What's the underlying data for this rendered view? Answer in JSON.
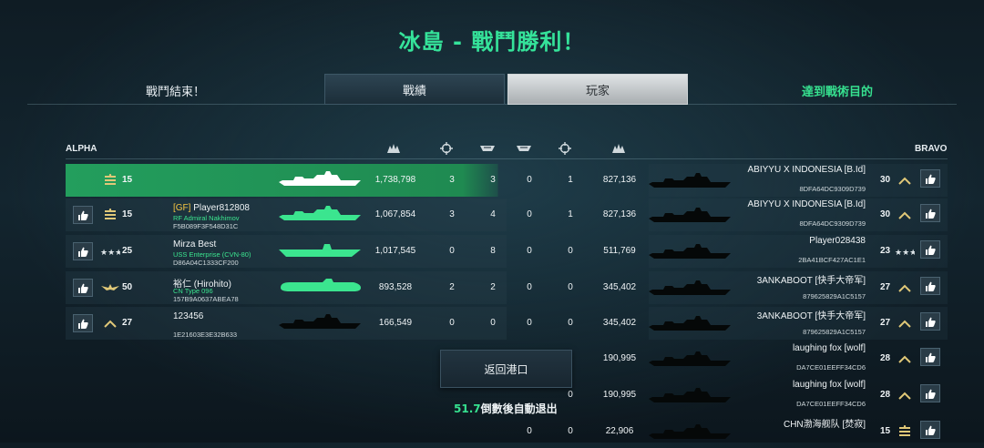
{
  "title": "冰島 - 戰鬥勝利！",
  "header": {
    "battle_end": "戰鬥結束！",
    "tabs": [
      "戰績",
      "玩家"
    ],
    "objective": "達到戰術目的"
  },
  "teams": {
    "left": "ALPHA",
    "right": "BRAVO"
  },
  "column_icons": [
    "damage-icon",
    "crosshair-icon",
    "ship-kill-icon",
    "ship-kill-icon",
    "crosshair-icon",
    "damage-icon"
  ],
  "rows": [
    {
      "left_rank": "15",
      "left_rank_icon": "rank-bars-icon",
      "left_clan": "",
      "left_name": "",
      "left_ship": "",
      "left_id": "",
      "damage_l": "1,738,798",
      "c1": "3",
      "c2": "3",
      "c3": "0",
      "c4": "1",
      "damage_r": "827,136",
      "right_name": "ABIYYU X INDONESIA ",
      "right_clan": "[B.Id]",
      "right_id": "8DFA64DC9309D739",
      "right_rank": "30",
      "right_rank_icon": "rank-chevron-icon",
      "highlight": true
    },
    {
      "left_rank": "15",
      "left_rank_icon": "rank-bars-icon",
      "left_clan": "[GF]",
      "left_name": " Player812808",
      "left_ship": "RF Admiral Nakhimov",
      "left_id": "F5B089F3F548D31C",
      "damage_l": "1,067,854",
      "c1": "3",
      "c2": "4",
      "c3": "0",
      "c4": "1",
      "damage_r": "827,136",
      "right_name": "ABIYYU X INDONESIA ",
      "right_clan": "[B.Id]",
      "right_id": "8DFA64DC9309D739",
      "right_rank": "30",
      "right_rank_icon": "rank-chevron-icon",
      "highlight": false
    },
    {
      "left_rank": "25",
      "left_rank_icon": "rank-stars-icon",
      "left_clan": "",
      "left_name": "Mirza Best",
      "left_ship": "USS Enterprise (CVN-80)",
      "left_id": "D86A04C1333CF200",
      "damage_l": "1,017,545",
      "c1": "0",
      "c2": "8",
      "c3": "0",
      "c4": "0",
      "damage_r": "511,769",
      "right_name": "Player028438",
      "right_clan": "",
      "right_id": "2BA41BCF427AC1E1",
      "right_rank": "23",
      "right_rank_icon": "rank-stars-icon",
      "highlight": false
    },
    {
      "left_rank": "50",
      "left_rank_icon": "rank-eagle-icon",
      "left_clan": "",
      "left_name": "裕仁 (Hirohito)",
      "left_ship": "CN Type 096",
      "left_id": "157B9A0637ABEA78",
      "damage_l": "893,528",
      "c1": "2",
      "c2": "2",
      "c3": "0",
      "c4": "0",
      "damage_r": "345,402",
      "right_name": "3ANKABOOT ",
      "right_clan": "[快手大帝军]",
      "right_id": "879625829A1C5157",
      "right_rank": "27",
      "right_rank_icon": "rank-chevron-icon",
      "highlight": false
    },
    {
      "left_rank": "27",
      "left_rank_icon": "rank-chevron-icon",
      "left_clan": "",
      "left_name": "123456",
      "left_ship": "",
      "left_id": "1E21603E3E32B633",
      "damage_l": "166,549",
      "c1": "0",
      "c2": "0",
      "c3": "0",
      "c4": "0",
      "damage_r": "345,402",
      "right_name": "3ANKABOOT ",
      "right_clan": "[快手大帝军]",
      "right_id": "879625829A1C5157",
      "right_rank": "27",
      "right_rank_icon": "rank-chevron-icon",
      "highlight": false
    },
    {
      "damage_r": "190,995",
      "right_name": "laughing fox ",
      "right_clan": "[wolf]",
      "right_id": "DA7CE01EEFF34CD6",
      "right_rank": "28",
      "right_rank_icon": "rank-chevron-icon"
    },
    {
      "c4": "0",
      "damage_r": "190,995",
      "right_name": "laughing fox ",
      "right_clan": "[wolf]",
      "right_id": "DA7CE01EEFF34CD6",
      "right_rank": "28",
      "right_rank_icon": "rank-chevron-icon"
    },
    {
      "c3": "0",
      "c4": "0",
      "damage_r": "22,906",
      "right_name": "CHN渤海舰队 ",
      "right_clan": "[焚寂]",
      "right_id": "",
      "right_rank": "15",
      "right_rank_icon": "rank-bars-icon"
    }
  ],
  "return_button": "返回港口",
  "countdown": {
    "seconds": "51.7",
    "text": "倒數後自動退出"
  }
}
